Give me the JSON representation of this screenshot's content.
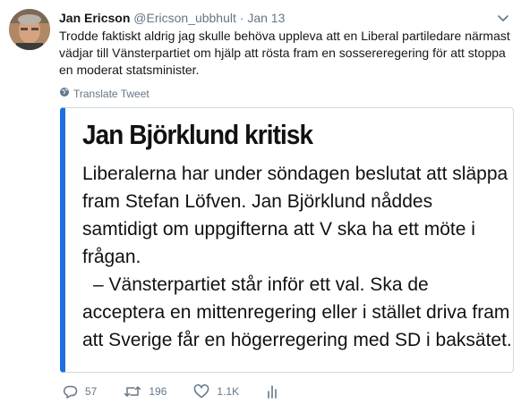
{
  "tweet": {
    "author_name": "Jan Ericson",
    "author_handle": "@Ericson_ubbhult",
    "separator": "·",
    "date": "Jan 13",
    "text": "Trodde faktiskt aldrig jag skulle behöva uppleva att en Liberal partiledare närmast vädjar till Vänsterpartiet om hjälp att rösta fram en sossereregering för att stoppa en moderat statsminister.",
    "translate_label": "Translate Tweet"
  },
  "card": {
    "title": "Jan Björklund kritisk",
    "paragraph1": "Liberalerna har under söndagen beslutat att släppa fram Stefan Löfven. Jan Björklund nåddes samtidigt om uppgifterna att V ska ha ett möte i frågan.",
    "paragraph2": "– Vänsterpartiet står inför ett val. Ska de acceptera en mittenregering eller i stället driva fram att Sverige får en högerregering med SD i baksätet."
  },
  "actions": {
    "replies": "57",
    "retweets": "196",
    "likes": "1.1K"
  },
  "icons": {
    "reply": "reply-icon",
    "retweet": "retweet-icon",
    "like": "heart-icon",
    "analytics": "analytics-icon",
    "menu": "chevron-down-icon",
    "globe": "globe-icon"
  },
  "colors": {
    "card_accent": "#1d6fe0",
    "muted": "#657786"
  }
}
